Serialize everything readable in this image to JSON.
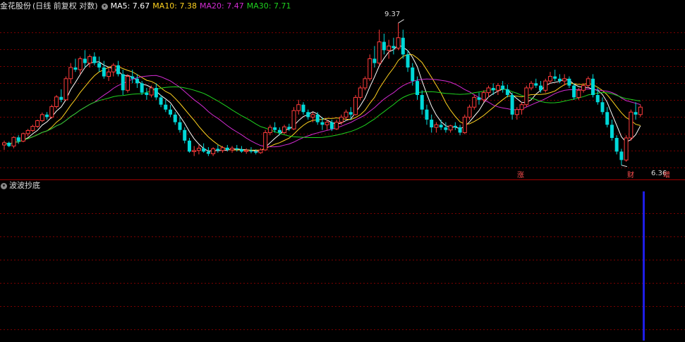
{
  "header": {
    "title": "金花股份",
    "period": "(日线 前复权 对数)",
    "ma": [
      {
        "label": "MA5: 7.67",
        "color": "#ffffff"
      },
      {
        "label": "MA10: 7.38",
        "color": "#ffd21f"
      },
      {
        "label": "MA20: 7.47",
        "color": "#d22cd2"
      },
      {
        "label": "MA30: 7.71",
        "color": "#1fd21f"
      }
    ]
  },
  "price_labels": {
    "high": "9.37",
    "low": "6.36"
  },
  "markers": {
    "zhang": "涨",
    "cai": "财",
    "zeng": "增"
  },
  "indicator": {
    "title": "波波抄底"
  },
  "colors": {
    "up": "#ff3c3c",
    "down": "#00d8d8",
    "grid": "#7a0000",
    "signal": "#1e1ee6",
    "separator": "#a00000"
  },
  "chart_data": {
    "type": "candlestick",
    "ylim": [
      6.2,
      9.6
    ],
    "log_scale": true,
    "candles": [
      [
        6.72,
        6.8,
        6.63,
        6.76
      ],
      [
        6.76,
        6.78,
        6.68,
        6.7
      ],
      [
        6.7,
        6.88,
        6.66,
        6.86
      ],
      [
        6.86,
        6.9,
        6.74,
        6.79
      ],
      [
        6.79,
        6.95,
        6.77,
        6.93
      ],
      [
        6.93,
        7.02,
        6.88,
        6.99
      ],
      [
        6.99,
        7.1,
        6.96,
        7.07
      ],
      [
        7.07,
        7.2,
        7.04,
        7.18
      ],
      [
        7.18,
        7.34,
        7.15,
        7.3
      ],
      [
        7.3,
        7.35,
        7.2,
        7.25
      ],
      [
        7.25,
        7.5,
        7.22,
        7.46
      ],
      [
        7.46,
        7.7,
        7.42,
        7.66
      ],
      [
        7.66,
        7.82,
        7.55,
        7.6
      ],
      [
        7.6,
        8.1,
        7.58,
        8.05
      ],
      [
        8.05,
        8.4,
        7.95,
        8.3
      ],
      [
        8.3,
        8.5,
        8.2,
        8.25
      ],
      [
        8.25,
        8.55,
        8.15,
        8.5
      ],
      [
        8.5,
        8.7,
        8.3,
        8.4
      ],
      [
        8.4,
        8.6,
        8.3,
        8.55
      ],
      [
        8.55,
        8.65,
        8.35,
        8.4
      ],
      [
        8.4,
        8.55,
        8.2,
        8.3
      ],
      [
        8.3,
        8.45,
        8.05,
        8.1
      ],
      [
        8.1,
        8.3,
        8.0,
        8.2
      ],
      [
        8.2,
        8.4,
        8.1,
        8.35
      ],
      [
        8.35,
        8.45,
        8.1,
        8.15
      ],
      [
        8.15,
        8.25,
        7.7,
        7.8
      ],
      [
        7.8,
        8.15,
        7.75,
        8.1
      ],
      [
        8.1,
        8.25,
        7.95,
        8.05
      ],
      [
        8.05,
        8.15,
        7.85,
        7.95
      ],
      [
        7.95,
        8.0,
        7.7,
        7.75
      ],
      [
        7.75,
        7.85,
        7.6,
        7.7
      ],
      [
        7.7,
        7.9,
        7.65,
        7.85
      ],
      [
        7.85,
        7.95,
        7.6,
        7.65
      ],
      [
        7.65,
        7.7,
        7.45,
        7.5
      ],
      [
        7.5,
        7.6,
        7.35,
        7.4
      ],
      [
        7.4,
        7.5,
        7.25,
        7.3
      ],
      [
        7.3,
        7.35,
        7.1,
        7.15
      ],
      [
        7.15,
        7.25,
        6.95,
        7.0
      ],
      [
        7.0,
        7.05,
        6.75,
        6.8
      ],
      [
        6.8,
        6.85,
        6.58,
        6.6
      ],
      [
        6.6,
        6.7,
        6.52,
        6.62
      ],
      [
        6.62,
        6.72,
        6.55,
        6.66
      ],
      [
        6.66,
        6.75,
        6.58,
        6.6
      ],
      [
        6.6,
        6.68,
        6.52,
        6.56
      ],
      [
        6.56,
        6.68,
        6.52,
        6.65
      ],
      [
        6.65,
        6.72,
        6.58,
        6.62
      ],
      [
        6.62,
        6.7,
        6.58,
        6.67
      ],
      [
        6.67,
        6.72,
        6.6,
        6.63
      ],
      [
        6.63,
        6.7,
        6.58,
        6.66
      ],
      [
        6.66,
        6.72,
        6.6,
        6.64
      ],
      [
        6.64,
        6.7,
        6.58,
        6.6
      ],
      [
        6.6,
        6.66,
        6.56,
        6.62
      ],
      [
        6.62,
        6.68,
        6.57,
        6.6
      ],
      [
        6.6,
        6.64,
        6.55,
        6.58
      ],
      [
        6.58,
        6.66,
        6.56,
        6.63
      ],
      [
        6.63,
        7.0,
        6.62,
        6.95
      ],
      [
        6.95,
        7.1,
        6.9,
        7.05
      ],
      [
        7.05,
        7.15,
        6.95,
        7.0
      ],
      [
        7.0,
        7.05,
        6.9,
        6.95
      ],
      [
        6.95,
        7.1,
        6.92,
        7.06
      ],
      [
        7.06,
        7.12,
        6.98,
        7.02
      ],
      [
        7.02,
        7.45,
        7.0,
        7.38
      ],
      [
        7.38,
        7.6,
        7.3,
        7.5
      ],
      [
        7.5,
        7.55,
        7.3,
        7.35
      ],
      [
        7.35,
        7.4,
        7.2,
        7.25
      ],
      [
        7.25,
        7.35,
        7.15,
        7.3
      ],
      [
        7.3,
        7.35,
        7.1,
        7.15
      ],
      [
        7.15,
        7.25,
        7.0,
        7.1
      ],
      [
        7.1,
        7.2,
        7.0,
        7.15
      ],
      [
        7.15,
        7.2,
        6.98,
        7.02
      ],
      [
        7.02,
        7.2,
        7.0,
        7.15
      ],
      [
        7.15,
        7.3,
        7.1,
        7.25
      ],
      [
        7.25,
        7.4,
        7.2,
        7.35
      ],
      [
        7.35,
        7.45,
        7.2,
        7.3
      ],
      [
        7.3,
        7.7,
        7.28,
        7.65
      ],
      [
        7.65,
        7.9,
        7.6,
        7.85
      ],
      [
        7.85,
        8.1,
        7.8,
        8.05
      ],
      [
        8.05,
        8.6,
        8.0,
        8.5
      ],
      [
        8.5,
        8.8,
        8.3,
        8.4
      ],
      [
        8.4,
        9.2,
        8.35,
        8.9
      ],
      [
        8.9,
        9.1,
        8.6,
        8.7
      ],
      [
        8.7,
        8.95,
        8.5,
        8.8
      ],
      [
        8.8,
        9.0,
        8.6,
        8.75
      ],
      [
        8.75,
        9.37,
        8.7,
        9.0
      ],
      [
        9.0,
        9.2,
        8.5,
        8.6
      ],
      [
        8.6,
        8.7,
        8.2,
        8.3
      ],
      [
        8.3,
        8.4,
        7.9,
        8.0
      ],
      [
        8.0,
        8.1,
        7.6,
        7.7
      ],
      [
        7.7,
        7.8,
        7.3,
        7.4
      ],
      [
        7.4,
        7.5,
        7.1,
        7.2
      ],
      [
        7.2,
        7.3,
        6.95,
        7.05
      ],
      [
        7.05,
        7.15,
        6.95,
        7.1
      ],
      [
        7.1,
        7.2,
        7.0,
        7.05
      ],
      [
        7.05,
        7.15,
        6.95,
        7.0
      ],
      [
        7.0,
        7.1,
        6.95,
        7.08
      ],
      [
        7.08,
        7.15,
        7.0,
        7.05
      ],
      [
        7.05,
        7.1,
        6.9,
        6.95
      ],
      [
        6.95,
        7.3,
        6.92,
        7.25
      ],
      [
        7.25,
        7.5,
        7.2,
        7.45
      ],
      [
        7.45,
        7.7,
        7.4,
        7.65
      ],
      [
        7.65,
        7.75,
        7.5,
        7.6
      ],
      [
        7.6,
        7.8,
        7.55,
        7.75
      ],
      [
        7.75,
        7.9,
        7.65,
        7.85
      ],
      [
        7.85,
        7.95,
        7.7,
        7.8
      ],
      [
        7.8,
        7.95,
        7.7,
        7.9
      ],
      [
        7.9,
        8.0,
        7.75,
        7.82
      ],
      [
        7.82,
        7.92,
        7.65,
        7.7
      ],
      [
        7.7,
        7.75,
        7.2,
        7.3
      ],
      [
        7.3,
        7.45,
        7.2,
        7.4
      ],
      [
        7.4,
        7.55,
        7.3,
        7.5
      ],
      [
        7.5,
        7.9,
        7.45,
        7.85
      ],
      [
        7.85,
        8.0,
        7.8,
        7.95
      ],
      [
        7.95,
        8.05,
        7.85,
        7.9
      ],
      [
        7.9,
        8.0,
        7.75,
        7.8
      ],
      [
        7.8,
        8.05,
        7.75,
        8.0
      ],
      [
        8.0,
        8.2,
        7.95,
        8.1
      ],
      [
        8.1,
        8.25,
        8.0,
        8.05
      ],
      [
        8.05,
        8.15,
        7.95,
        8.0
      ],
      [
        8.0,
        8.15,
        7.9,
        8.05
      ],
      [
        8.05,
        8.1,
        7.85,
        7.9
      ],
      [
        7.9,
        7.95,
        7.6,
        7.65
      ],
      [
        7.65,
        7.85,
        7.6,
        7.8
      ],
      [
        7.8,
        7.95,
        7.75,
        7.9
      ],
      [
        7.9,
        8.1,
        7.85,
        8.05
      ],
      [
        8.05,
        8.15,
        7.65,
        7.7
      ],
      [
        7.7,
        7.85,
        7.5,
        7.55
      ],
      [
        7.55,
        7.65,
        7.3,
        7.35
      ],
      [
        7.35,
        7.45,
        7.05,
        7.1
      ],
      [
        7.1,
        7.2,
        6.8,
        6.85
      ],
      [
        6.85,
        6.9,
        6.55,
        6.6
      ],
      [
        6.6,
        6.65,
        6.36,
        6.45
      ],
      [
        6.45,
        6.9,
        6.42,
        6.85
      ],
      [
        6.85,
        7.4,
        6.8,
        7.35
      ],
      [
        7.35,
        7.55,
        7.2,
        7.3
      ],
      [
        7.3,
        7.5,
        7.25,
        7.45
      ]
    ]
  }
}
